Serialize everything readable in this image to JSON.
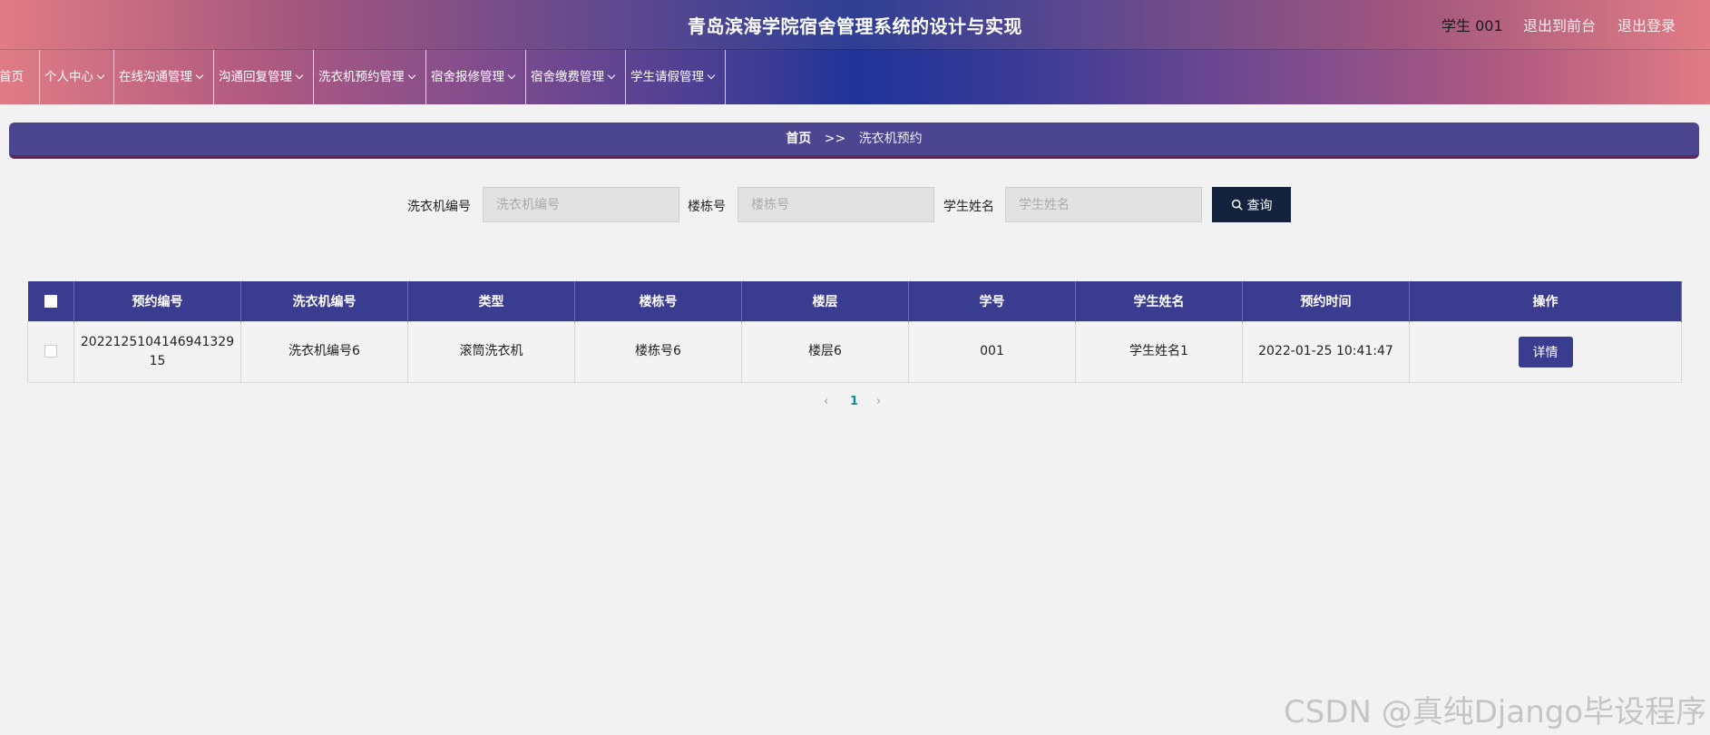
{
  "header": {
    "title": "青岛滨海学院宿舍管理系统的设计与实现",
    "user": "学生 001",
    "front_link": "退出到前台",
    "logout_link": "退出登录"
  },
  "nav": {
    "items": [
      {
        "label": "首页"
      },
      {
        "label": "个人中心"
      },
      {
        "label": "在线沟通管理"
      },
      {
        "label": "沟通回复管理"
      },
      {
        "label": "洗衣机预约管理"
      },
      {
        "label": "宿舍报修管理"
      },
      {
        "label": "宿舍缴费管理"
      },
      {
        "label": "学生请假管理"
      }
    ]
  },
  "breadcrumb": {
    "home": "首页",
    "separator": ">>",
    "current": "洗衣机预约"
  },
  "search": {
    "washer_label": "洗衣机编号",
    "washer_placeholder": "洗衣机编号",
    "building_label": "楼栋号",
    "building_placeholder": "楼栋号",
    "student_label": "学生姓名",
    "student_placeholder": "学生姓名",
    "button": "查询"
  },
  "table": {
    "columns": [
      "预约编号",
      "洗衣机编号",
      "类型",
      "楼栋号",
      "楼层",
      "学号",
      "学生姓名",
      "预约时间",
      "操作"
    ],
    "rows": [
      {
        "booking_id": "2022125104146941329 15",
        "washer_id": "洗衣机编号6",
        "type": "滚筒洗衣机",
        "building": "楼栋号6",
        "floor": "楼层6",
        "student_no": "001",
        "student_name": "学生姓名1",
        "time": "2022-01-25 10:41:47",
        "action": "详情"
      }
    ]
  },
  "pagination": {
    "prev": "‹",
    "current": "1",
    "next": "›"
  },
  "watermark": "CSDN @真纯Django毕设程序"
}
